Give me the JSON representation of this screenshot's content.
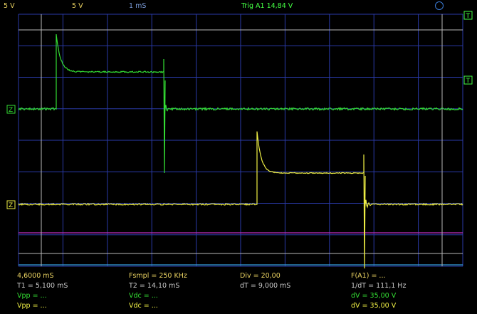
{
  "colors": {
    "ch1": "#33dd33",
    "ch2": "#eeee44",
    "grid": "#2a3aa8",
    "cursor": "#b8b8b8",
    "cursor_magenta": "#c02fc0",
    "cursor_blue": "#36a0e0",
    "trigger": "#44ff44",
    "label_amber": "#e8d060",
    "label_blue": "#7a9bd8",
    "label_white": "#c8c8c8",
    "icon_blue": "#3a7bd5"
  },
  "header": {
    "ch1_scale": "5 V",
    "ch2_scale": "5 V",
    "timebase": "1 mS",
    "trigger": "Trig A1  14,84 V"
  },
  "readout": {
    "row1": {
      "time": "4,6000 mS",
      "fsmpl": "Fsmpl = 250 KHz",
      "div": "Div = 20,00",
      "fa1": "F(A1) = ..."
    },
    "row2": {
      "t1": "T1 = 5,100 mS",
      "t2": "T2 = 14,10 mS",
      "dt": "dT = 9,000 mS",
      "inv_dt": "1/dT = 111,1 Hz"
    },
    "row3": {
      "vpp": "Vpp = ...",
      "vdc": "Vdc = ...",
      "dv": "dV = 35,00 V"
    },
    "row4": {
      "vpp": "Vpp = ...",
      "vdc": "Vdc = ...",
      "dv": "dV = 35,00 V"
    }
  },
  "markers": {
    "ground": "Z",
    "trigger": "T"
  }
}
